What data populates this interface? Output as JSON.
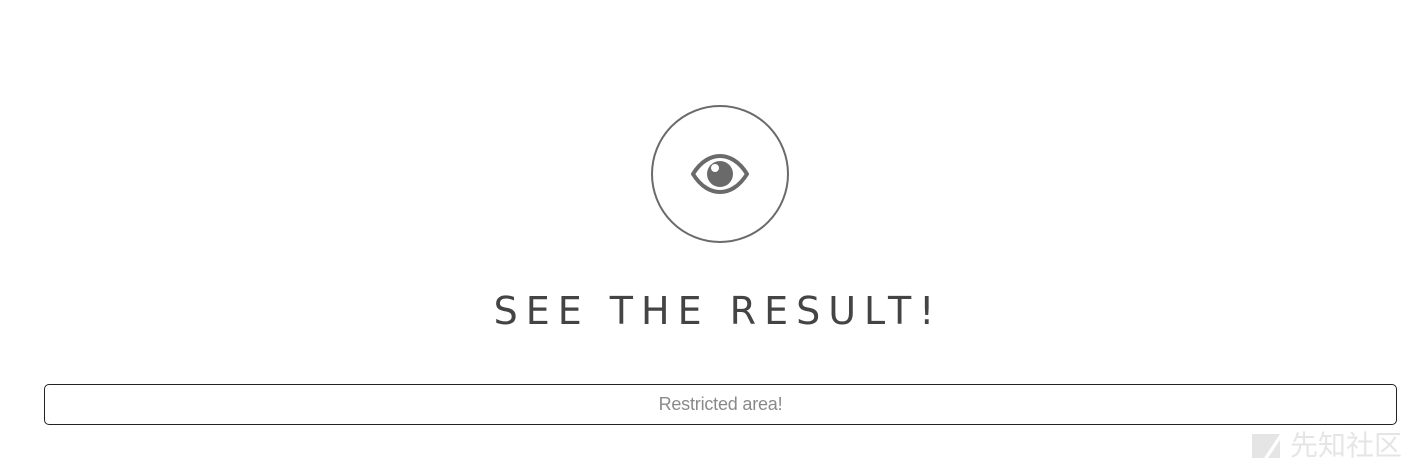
{
  "hero": {
    "icon": "eye-icon",
    "title": "SEE THE RESULT!"
  },
  "result": {
    "text": "Restricted area!"
  },
  "watermark": {
    "text": "先知社区"
  },
  "colors": {
    "icon": "#6a6a6a",
    "title": "#444444",
    "box_border": "#222222",
    "box_text": "#8a8a8a"
  }
}
